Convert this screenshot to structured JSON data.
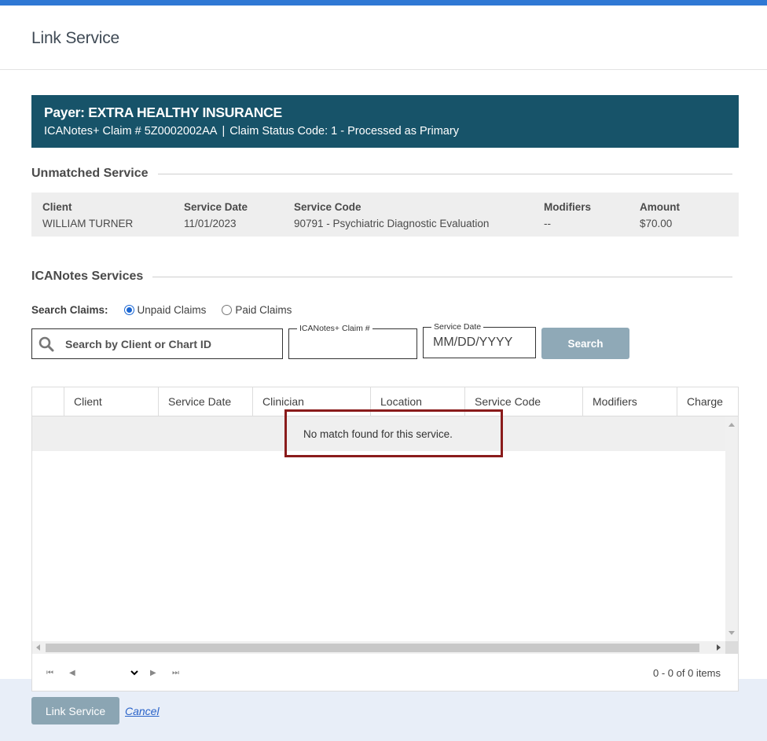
{
  "modal": {
    "title": "Link Service"
  },
  "payer": {
    "title": "Payer: EXTRA HEALTHY INSURANCE",
    "claim": "ICANotes+ Claim # 5Z0002002AA",
    "separator": "|",
    "status": "Claim Status Code: 1 - Processed as Primary"
  },
  "unmatched": {
    "section_title": "Unmatched Service",
    "columns": [
      {
        "header": "Client",
        "value": "WILLIAM TURNER"
      },
      {
        "header": "Service Date",
        "value": "11/01/2023"
      },
      {
        "header": "Service Code",
        "value": "90791 - Psychiatric Diagnostic Evaluation"
      },
      {
        "header": "Modifiers",
        "value": "--"
      },
      {
        "header": "Amount",
        "value": "$70.00"
      }
    ]
  },
  "services": {
    "section_title": "ICANotes Services",
    "search_label": "Search Claims:",
    "radio_unpaid": "Unpaid Claims",
    "radio_paid": "Paid Claims",
    "search_placeholder": "Search by Client or Chart ID",
    "claim_legend": "ICANotes+ Claim #",
    "claim_value": "",
    "date_legend": "Service Date",
    "date_placeholder": "MM/DD/YYYY",
    "search_button": "Search"
  },
  "grid": {
    "headers": [
      "Client",
      "Service Date",
      "Clinician",
      "Location",
      "Service Code",
      "Modifiers",
      "Charge"
    ],
    "empty_message": "No match found for this service.",
    "pager_info": "0 - 0 of 0 items"
  },
  "footer": {
    "link_button": "Link Service",
    "cancel_link": "Cancel"
  },
  "colors": {
    "topbar": "#2f78d4",
    "payer_banner": "#175369",
    "highlight_border": "#8a1b1b",
    "button_disabled": "#8fa9b7",
    "footer_bg": "#e8eef8"
  }
}
